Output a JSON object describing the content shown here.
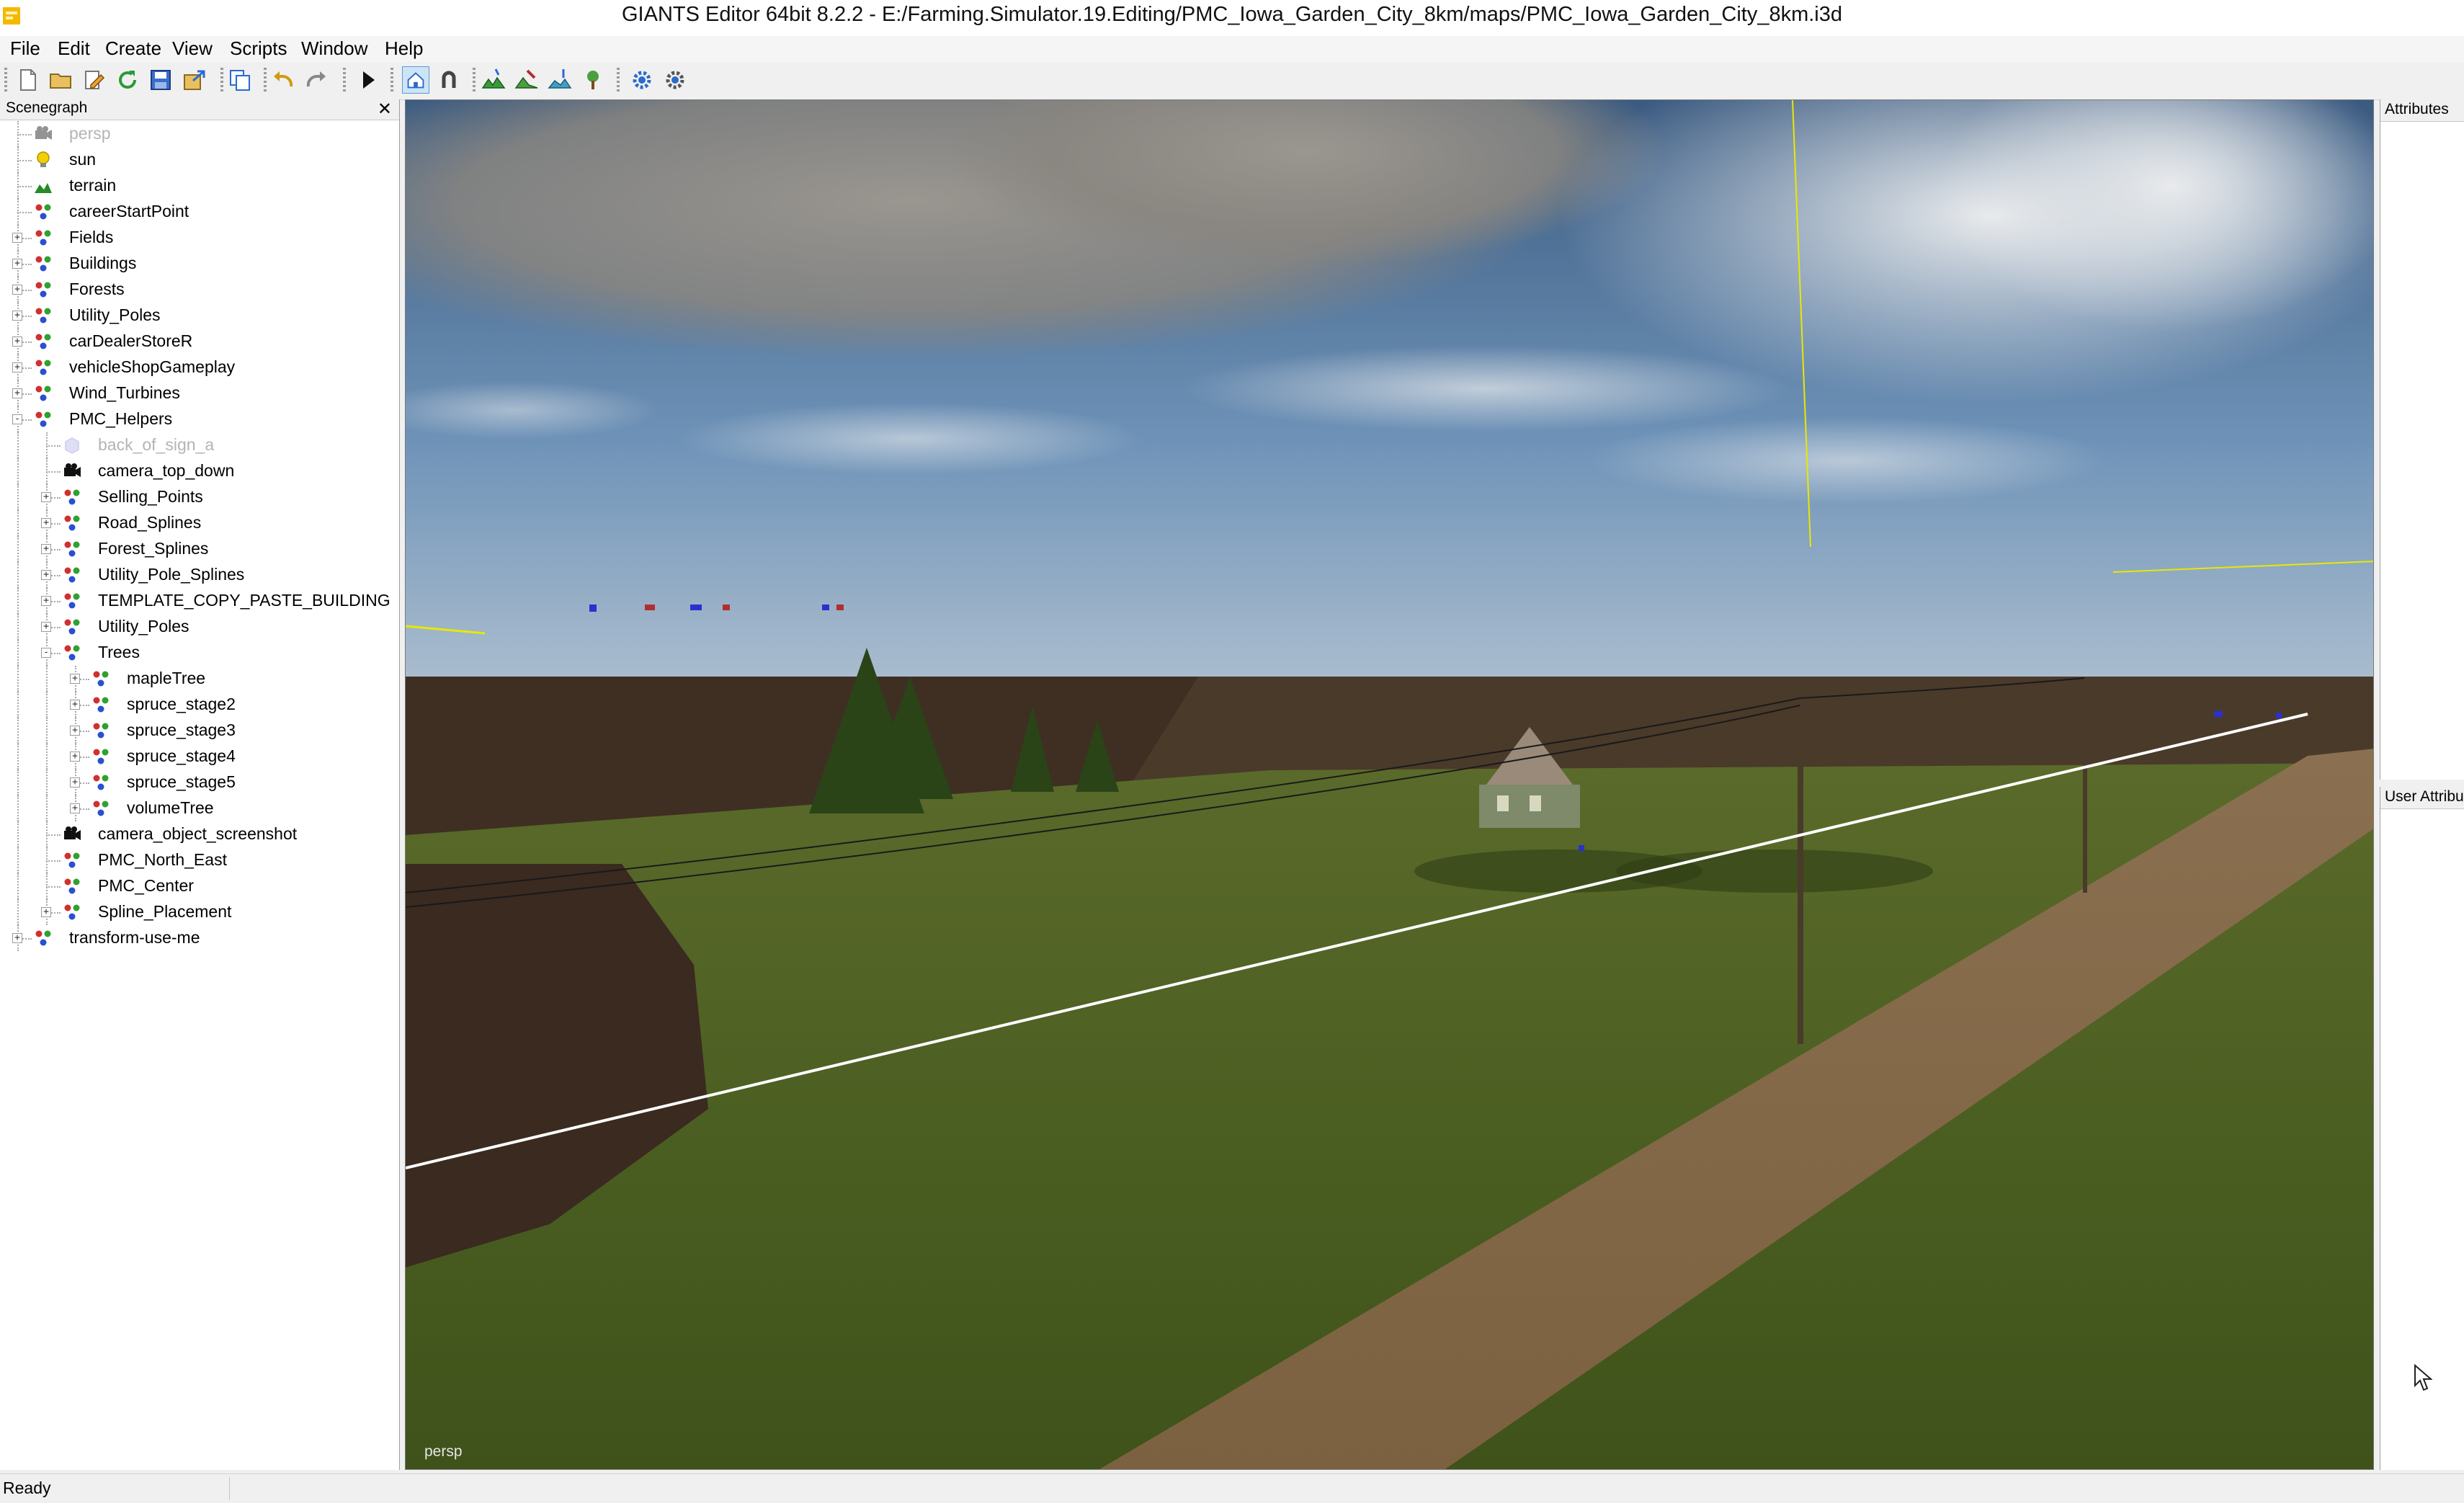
{
  "window": {
    "title": "GIANTS Editor 64bit 8.2.2 - E:/Farming.Simulator.19.Editing/PMC_Iowa_Garden_City_8km/maps/PMC_Iowa_Garden_City_8km.i3d"
  },
  "menu": [
    "File",
    "Edit",
    "Create",
    "View",
    "Scripts",
    "Window",
    "Help"
  ],
  "toolbar": {
    "buttons": [
      "new-file-icon",
      "open-folder-icon",
      "edit-icon",
      "refresh-icon",
      "save-icon",
      "export-icon",
      "copy-icon",
      "undo-icon",
      "redo-icon",
      "play-icon",
      "home-camera-icon",
      "magnet-icon",
      "terrain-paint-icon",
      "terrain-sculpt-icon",
      "foliage-paint-icon",
      "placement-icon",
      "settings-gear-icon",
      "reload-gear-icon"
    ]
  },
  "scenegraph": {
    "title": "Scenegraph",
    "nodes": [
      {
        "label": "persp",
        "depth": 0,
        "icon": "camera",
        "expander": "",
        "dim": true
      },
      {
        "label": "sun",
        "depth": 0,
        "icon": "light",
        "expander": ""
      },
      {
        "label": "terrain",
        "depth": 0,
        "icon": "terrain",
        "expander": ""
      },
      {
        "label": "careerStartPoint",
        "depth": 0,
        "icon": "transform",
        "expander": ""
      },
      {
        "label": "Fields",
        "depth": 0,
        "icon": "transform",
        "expander": "+"
      },
      {
        "label": "Buildings",
        "depth": 0,
        "icon": "transform",
        "expander": "+"
      },
      {
        "label": "Forests",
        "depth": 0,
        "icon": "transform",
        "expander": "+"
      },
      {
        "label": "Utility_Poles",
        "depth": 0,
        "icon": "transform",
        "expander": "+"
      },
      {
        "label": "carDealerStoreR",
        "depth": 0,
        "icon": "transform",
        "expander": "+"
      },
      {
        "label": "vehicleShopGameplay",
        "depth": 0,
        "icon": "transform",
        "expander": "+"
      },
      {
        "label": "Wind_Turbines",
        "depth": 0,
        "icon": "transform",
        "expander": "+"
      },
      {
        "label": "PMC_Helpers",
        "depth": 0,
        "icon": "transform",
        "expander": "-"
      },
      {
        "label": "back_of_sign_a",
        "depth": 1,
        "icon": "shape",
        "expander": "",
        "dim": true
      },
      {
        "label": "camera_top_down",
        "depth": 1,
        "icon": "camera",
        "expander": ""
      },
      {
        "label": "Selling_Points",
        "depth": 1,
        "icon": "transform",
        "expander": "+"
      },
      {
        "label": "Road_Splines",
        "depth": 1,
        "icon": "transform",
        "expander": "+"
      },
      {
        "label": "Forest_Splines",
        "depth": 1,
        "icon": "transform",
        "expander": "+"
      },
      {
        "label": "Utility_Pole_Splines",
        "depth": 1,
        "icon": "transform",
        "expander": "+"
      },
      {
        "label": "TEMPLATE_COPY_PASTE_BUILDING",
        "depth": 1,
        "icon": "transform",
        "expander": "+"
      },
      {
        "label": "Utility_Poles",
        "depth": 1,
        "icon": "transform",
        "expander": "+"
      },
      {
        "label": "Trees",
        "depth": 1,
        "icon": "transform",
        "expander": "-"
      },
      {
        "label": "mapleTree",
        "depth": 2,
        "icon": "transform",
        "expander": "+"
      },
      {
        "label": "spruce_stage2",
        "depth": 2,
        "icon": "transform",
        "expander": "+"
      },
      {
        "label": "spruce_stage3",
        "depth": 2,
        "icon": "transform",
        "expander": "+"
      },
      {
        "label": "spruce_stage4",
        "depth": 2,
        "icon": "transform",
        "expander": "+"
      },
      {
        "label": "spruce_stage5",
        "depth": 2,
        "icon": "transform",
        "expander": "+"
      },
      {
        "label": "volumeTree",
        "depth": 2,
        "icon": "transform",
        "expander": "+"
      },
      {
        "label": "camera_object_screenshot",
        "depth": 1,
        "icon": "camera",
        "expander": ""
      },
      {
        "label": "PMC_North_East",
        "depth": 1,
        "icon": "transform",
        "expander": ""
      },
      {
        "label": "PMC_Center",
        "depth": 1,
        "icon": "transform",
        "expander": ""
      },
      {
        "label": "Spline_Placement",
        "depth": 1,
        "icon": "transform",
        "expander": "+"
      },
      {
        "label": "transform-use-me",
        "depth": 0,
        "icon": "transform",
        "expander": "+"
      }
    ]
  },
  "viewport": {
    "camera_label": "persp"
  },
  "attributes_panel": {
    "title": "Attributes"
  },
  "user_attributes_panel": {
    "title": "User Attribu"
  },
  "status": {
    "text": "Ready"
  }
}
